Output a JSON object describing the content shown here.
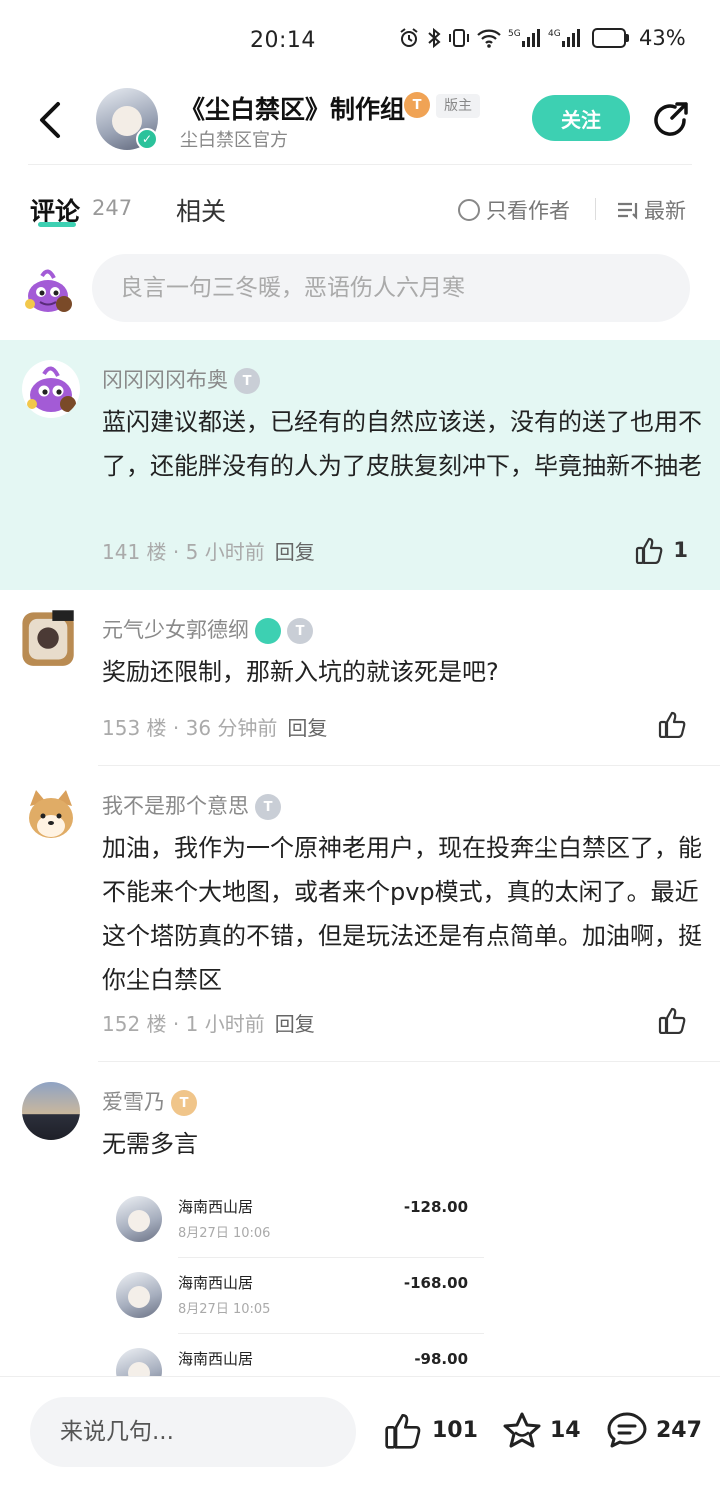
{
  "status_bar": {
    "time": "20:14",
    "battery": "43%",
    "battery_level": 0.43
  },
  "header": {
    "title": "《尘白禁区》制作组",
    "level_badge": "T",
    "moderator_badge": "版主",
    "subtitle": "尘白禁区官方",
    "follow_label": "关注"
  },
  "tabs": {
    "comments_label": "评论",
    "comments_count": "247",
    "related_label": "相关",
    "only_author_label": "只看作者",
    "sort_label": "最新"
  },
  "reply_input": {
    "placeholder": "良言一句三冬暖，恶语伤人六月寒"
  },
  "comments": [
    {
      "name": "冈冈冈冈布奥",
      "level": "T",
      "text": "蓝闪建议都送，已经有的自然应该送，没有的送了也用不了，还能胖没有的人为了皮肤复刻冲下，毕竟抽新不抽老",
      "floor": "141 楼",
      "time": "5 小时前",
      "reply": "回复",
      "likes": "1"
    },
    {
      "name": "元气少女郭德纲",
      "level": "T",
      "text": "奖励还限制，那新入坑的就该死是吧?",
      "floor": "153 楼",
      "time": "36 分钟前",
      "reply": "回复",
      "likes": ""
    },
    {
      "name": "我不是那个意思",
      "level": "T",
      "text": "加油，我作为一个原神老用户，现在投奔尘白禁区了，能不能来个大地图，或者来个pvp模式，真的太闲了。最近这个塔防真的不错，但是玩法还是有点简单。加油啊，挺你尘白禁区",
      "floor": "152 楼",
      "time": "1 小时前",
      "reply": "回复",
      "likes": ""
    },
    {
      "name": "爱雪乃",
      "level": "T",
      "text": "无需多言",
      "embedded_transactions": [
        {
          "name": "海南西山居",
          "date": "8月27日 10:06",
          "amount": "-128.00"
        },
        {
          "name": "海南西山居",
          "date": "8月27日 10:05",
          "amount": "-168.00"
        },
        {
          "name": "海南西山居",
          "date": "",
          "amount": "-98.00"
        }
      ]
    }
  ],
  "bottom_bar": {
    "input_placeholder": "来说几句...",
    "likes": "101",
    "favorites": "14",
    "comments": "247"
  },
  "colors": {
    "accent": "#3dd0b2",
    "highlight_bg": "#e4f7f3",
    "muted_text": "#8a8a8a"
  }
}
